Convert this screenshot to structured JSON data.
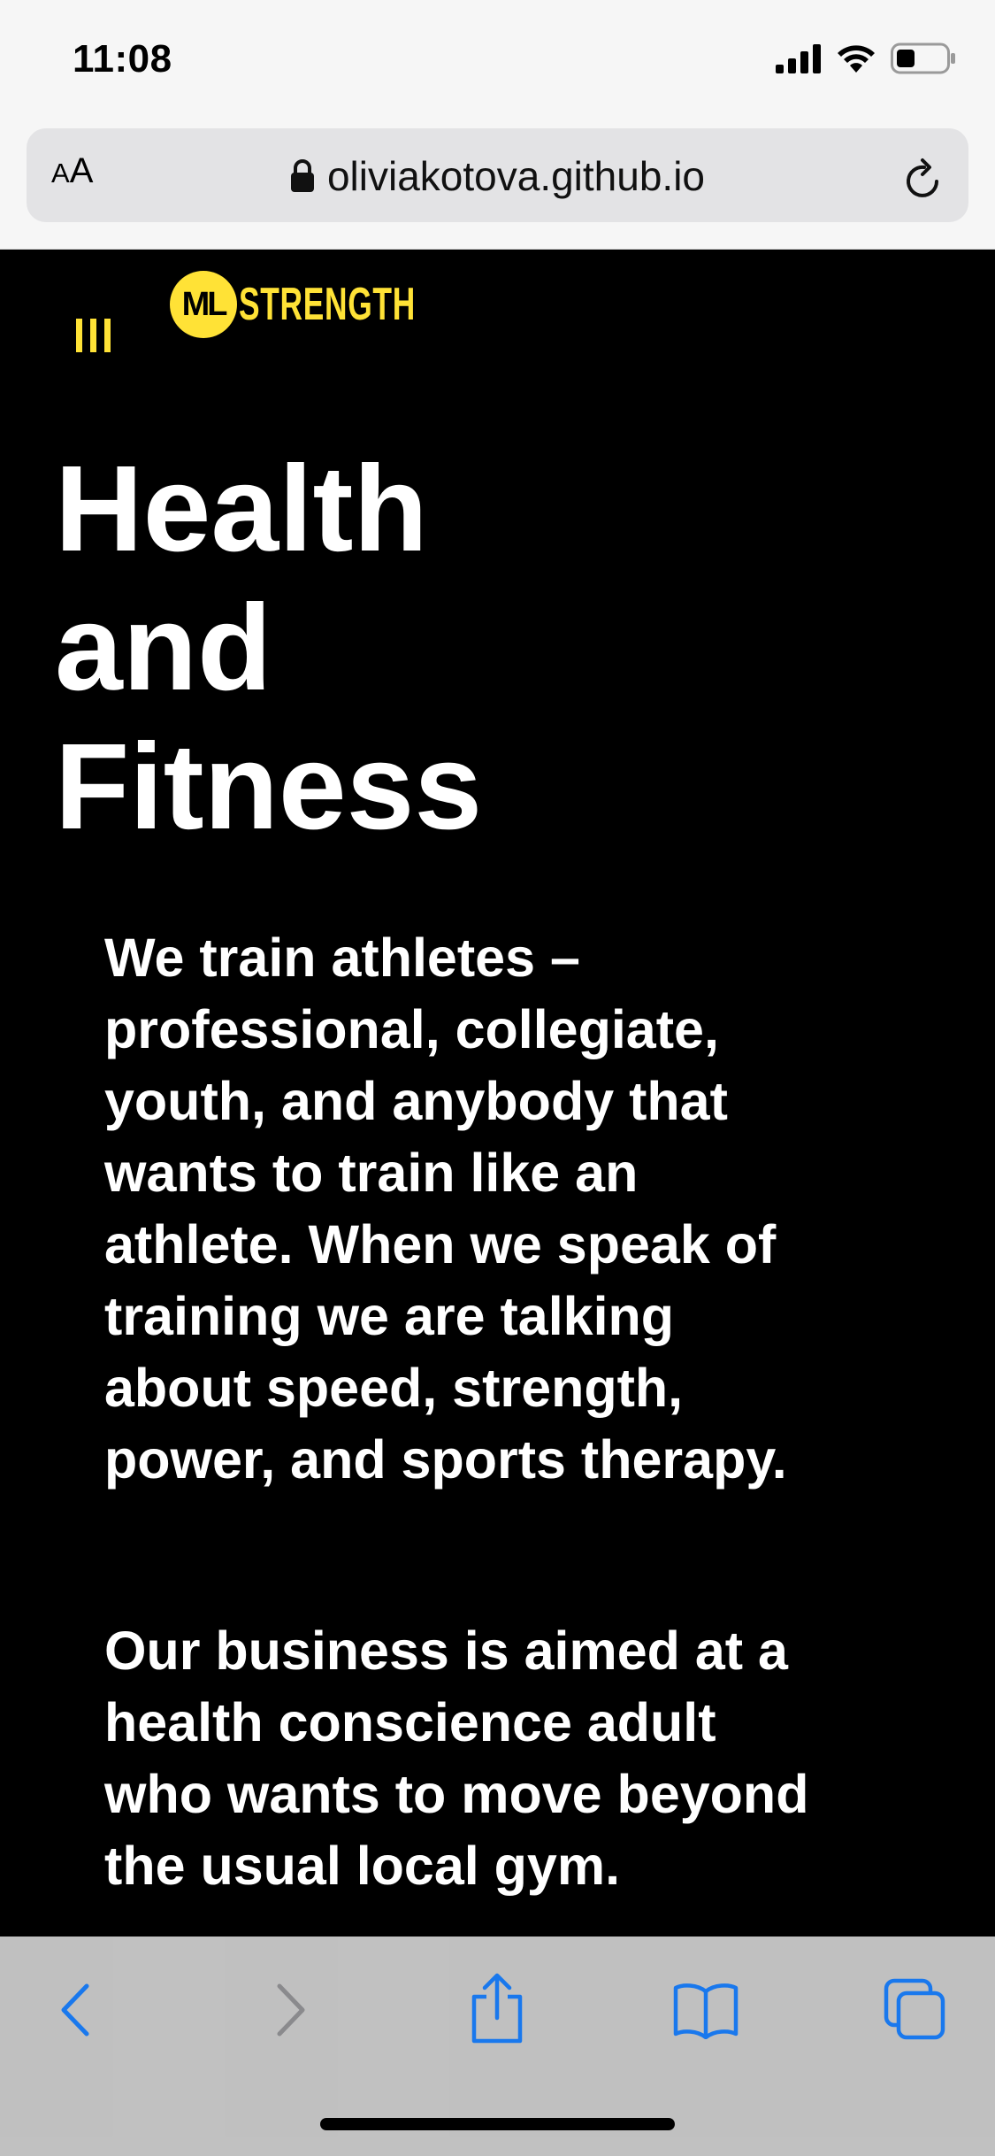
{
  "status": {
    "time": "11:08"
  },
  "browser": {
    "aa_small": "A",
    "aa_large": "A",
    "url": "oliviakotova.github.io"
  },
  "site": {
    "logo_mark": "ML",
    "logo_word": "STRENGTH",
    "hero_title": [
      "Health",
      "and",
      "Fitness"
    ],
    "paragraphs": [
      "We train athletes – professional, collegiate, youth, and anybody that wants to train like an athlete. When we speak of training we are talking about speed, strength, power, and sports therapy.",
      "Our business is aimed at a health conscience adult who wants to move beyond the usual local gym."
    ]
  },
  "colors": {
    "accent": "#ffe236",
    "ios_blue": "#1a7cf5",
    "background": "#000000"
  },
  "icons": [
    "signal-icon",
    "wifi-icon",
    "battery-icon",
    "lock-icon",
    "reload-icon",
    "menu-icon",
    "back-icon",
    "forward-icon",
    "share-icon",
    "bookmarks-icon",
    "tabs-icon"
  ]
}
